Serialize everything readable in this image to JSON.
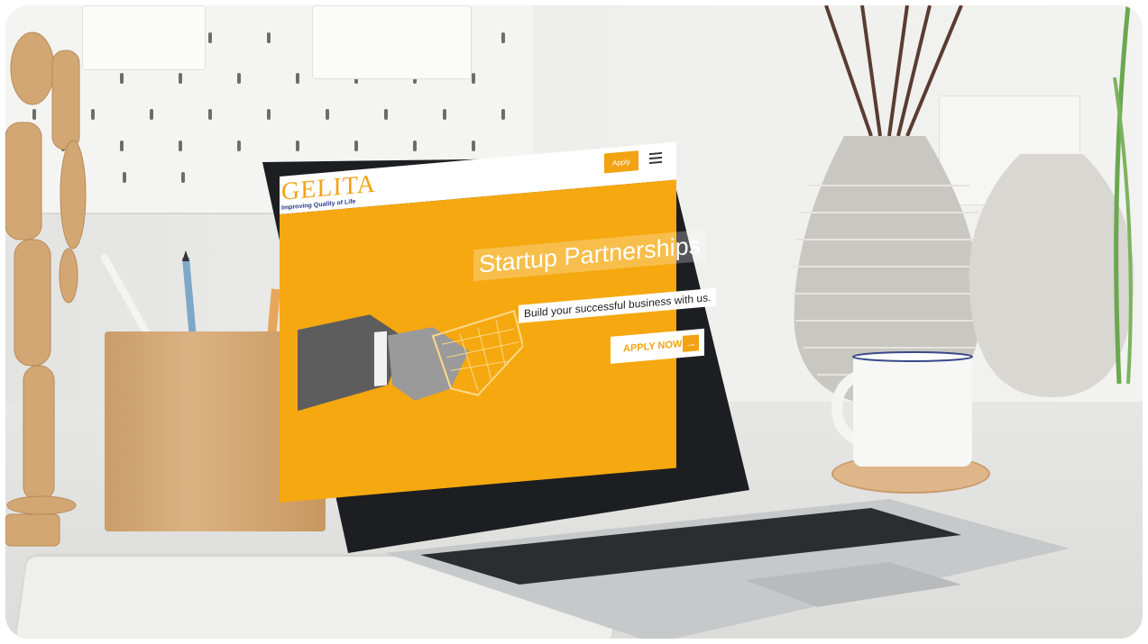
{
  "site": {
    "logo": "GELITA",
    "tagline": "Improving Quality of Life",
    "apply_label": "Apply",
    "menu_icon": "hamburger-icon"
  },
  "hero": {
    "title": "Startup Partnerships",
    "subtitle": "Build your successful business with us.",
    "cta_label": "APPLY NOW",
    "cta_icon": "arrow-right-icon"
  },
  "colors": {
    "brand_orange": "#f5a80f",
    "tagline_blue": "#2a3d8a"
  }
}
